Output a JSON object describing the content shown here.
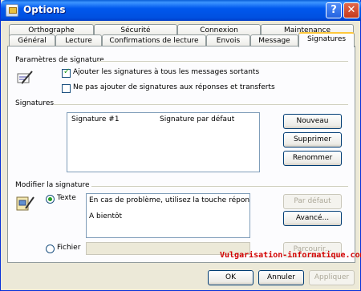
{
  "window": {
    "title": "Options"
  },
  "tabs_back": [
    "Orthographe",
    "Sécurité",
    "Connexion",
    "Maintenance"
  ],
  "tabs_front": [
    "Général",
    "Lecture",
    "Confirmations de lecture",
    "Envois",
    "Message",
    "Signatures"
  ],
  "active_tab": "Signatures",
  "params": {
    "group_label": "Paramètres de signature",
    "check1": {
      "label": "Ajouter les signatures à tous les messages sortants",
      "checked": true
    },
    "check2": {
      "label": "Ne pas ajouter de signatures aux réponses et transferts",
      "checked": false
    }
  },
  "signatures": {
    "group_label": "Signatures",
    "list": [
      {
        "name": "Signature #1",
        "status": "Signature par défaut"
      }
    ],
    "buttons": {
      "new": "Nouveau",
      "delete": "Supprimer",
      "rename": "Renommer"
    }
  },
  "edit": {
    "group_label": "Modifier la signature",
    "radio_text": "Texte",
    "radio_file": "Fichier",
    "text_line1": "En cas de problème, utilisez la touche répondre de vo",
    "text_line2": "A bientôt",
    "buttons": {
      "default": "Par défaut",
      "advanced": "Avancé...",
      "browse": "Parcourir..."
    },
    "file_value": ""
  },
  "watermark": "Vulgarisation-informatique.com",
  "footer": {
    "ok": "OK",
    "cancel": "Annuler",
    "apply": "Appliquer"
  }
}
